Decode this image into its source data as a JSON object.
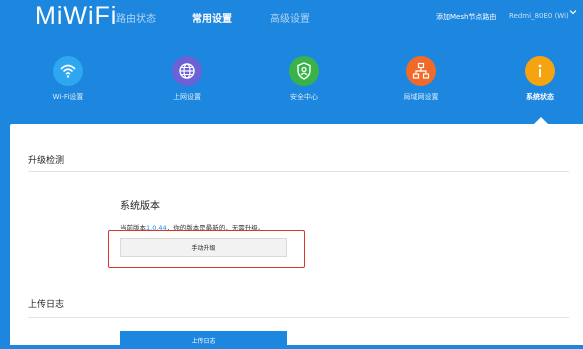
{
  "header": {
    "logo": "MiWiFi",
    "nav": [
      "路由状态",
      "常用设置",
      "高级设置"
    ],
    "mesh_link": "添加Mesh节点路由",
    "device_name": "Redmi_80E0 (Wi)"
  },
  "tiles": [
    {
      "label": "Wi-Fi设置",
      "icon": "wifi-icon",
      "color": "#2ea7f0"
    },
    {
      "label": "上网设置",
      "icon": "globe-icon",
      "color": "#6a62d6"
    },
    {
      "label": "安全中心",
      "icon": "shield-user-icon",
      "color": "#37b34a"
    },
    {
      "label": "局域网设置",
      "icon": "network-icon",
      "color": "#f06a2a"
    },
    {
      "label": "系统状态",
      "icon": "info-icon",
      "color": "#f6a312"
    }
  ],
  "upgrade": {
    "section_title": "升级检测",
    "system_version_label": "系统版本",
    "current_prefix": "当前版本",
    "version": "1.0.44",
    "current_suffix": "，你的版本是最新的，无需升级。",
    "manual_button": "手动升级"
  },
  "log": {
    "section_title": "上传日志",
    "upload_button": "上传日志"
  },
  "colors": {
    "brand_blue": "#1d86df",
    "highlight_red": "#e0322e"
  }
}
